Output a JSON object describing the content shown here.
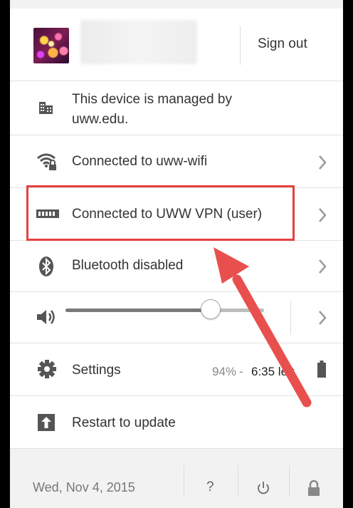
{
  "header": {
    "sign_out_label": "Sign out"
  },
  "managed": {
    "line1": "This device is managed by",
    "line2": "uww.edu."
  },
  "network": {
    "wifi_label": "Connected to uww-wifi",
    "vpn_label": "Connected to UWW VPN (user)"
  },
  "bluetooth": {
    "label": "Bluetooth disabled"
  },
  "volume": {
    "level": 0.73
  },
  "settings": {
    "label": "Settings",
    "battery_percent": "94%",
    "battery_sep": " - ",
    "battery_time": "6:35 left"
  },
  "update": {
    "label": "Restart to update"
  },
  "footer": {
    "date": "Wed, Nov 4, 2015",
    "help_label": "?"
  },
  "colors": {
    "highlight": "#e44040",
    "arrow": "#e8504e"
  }
}
